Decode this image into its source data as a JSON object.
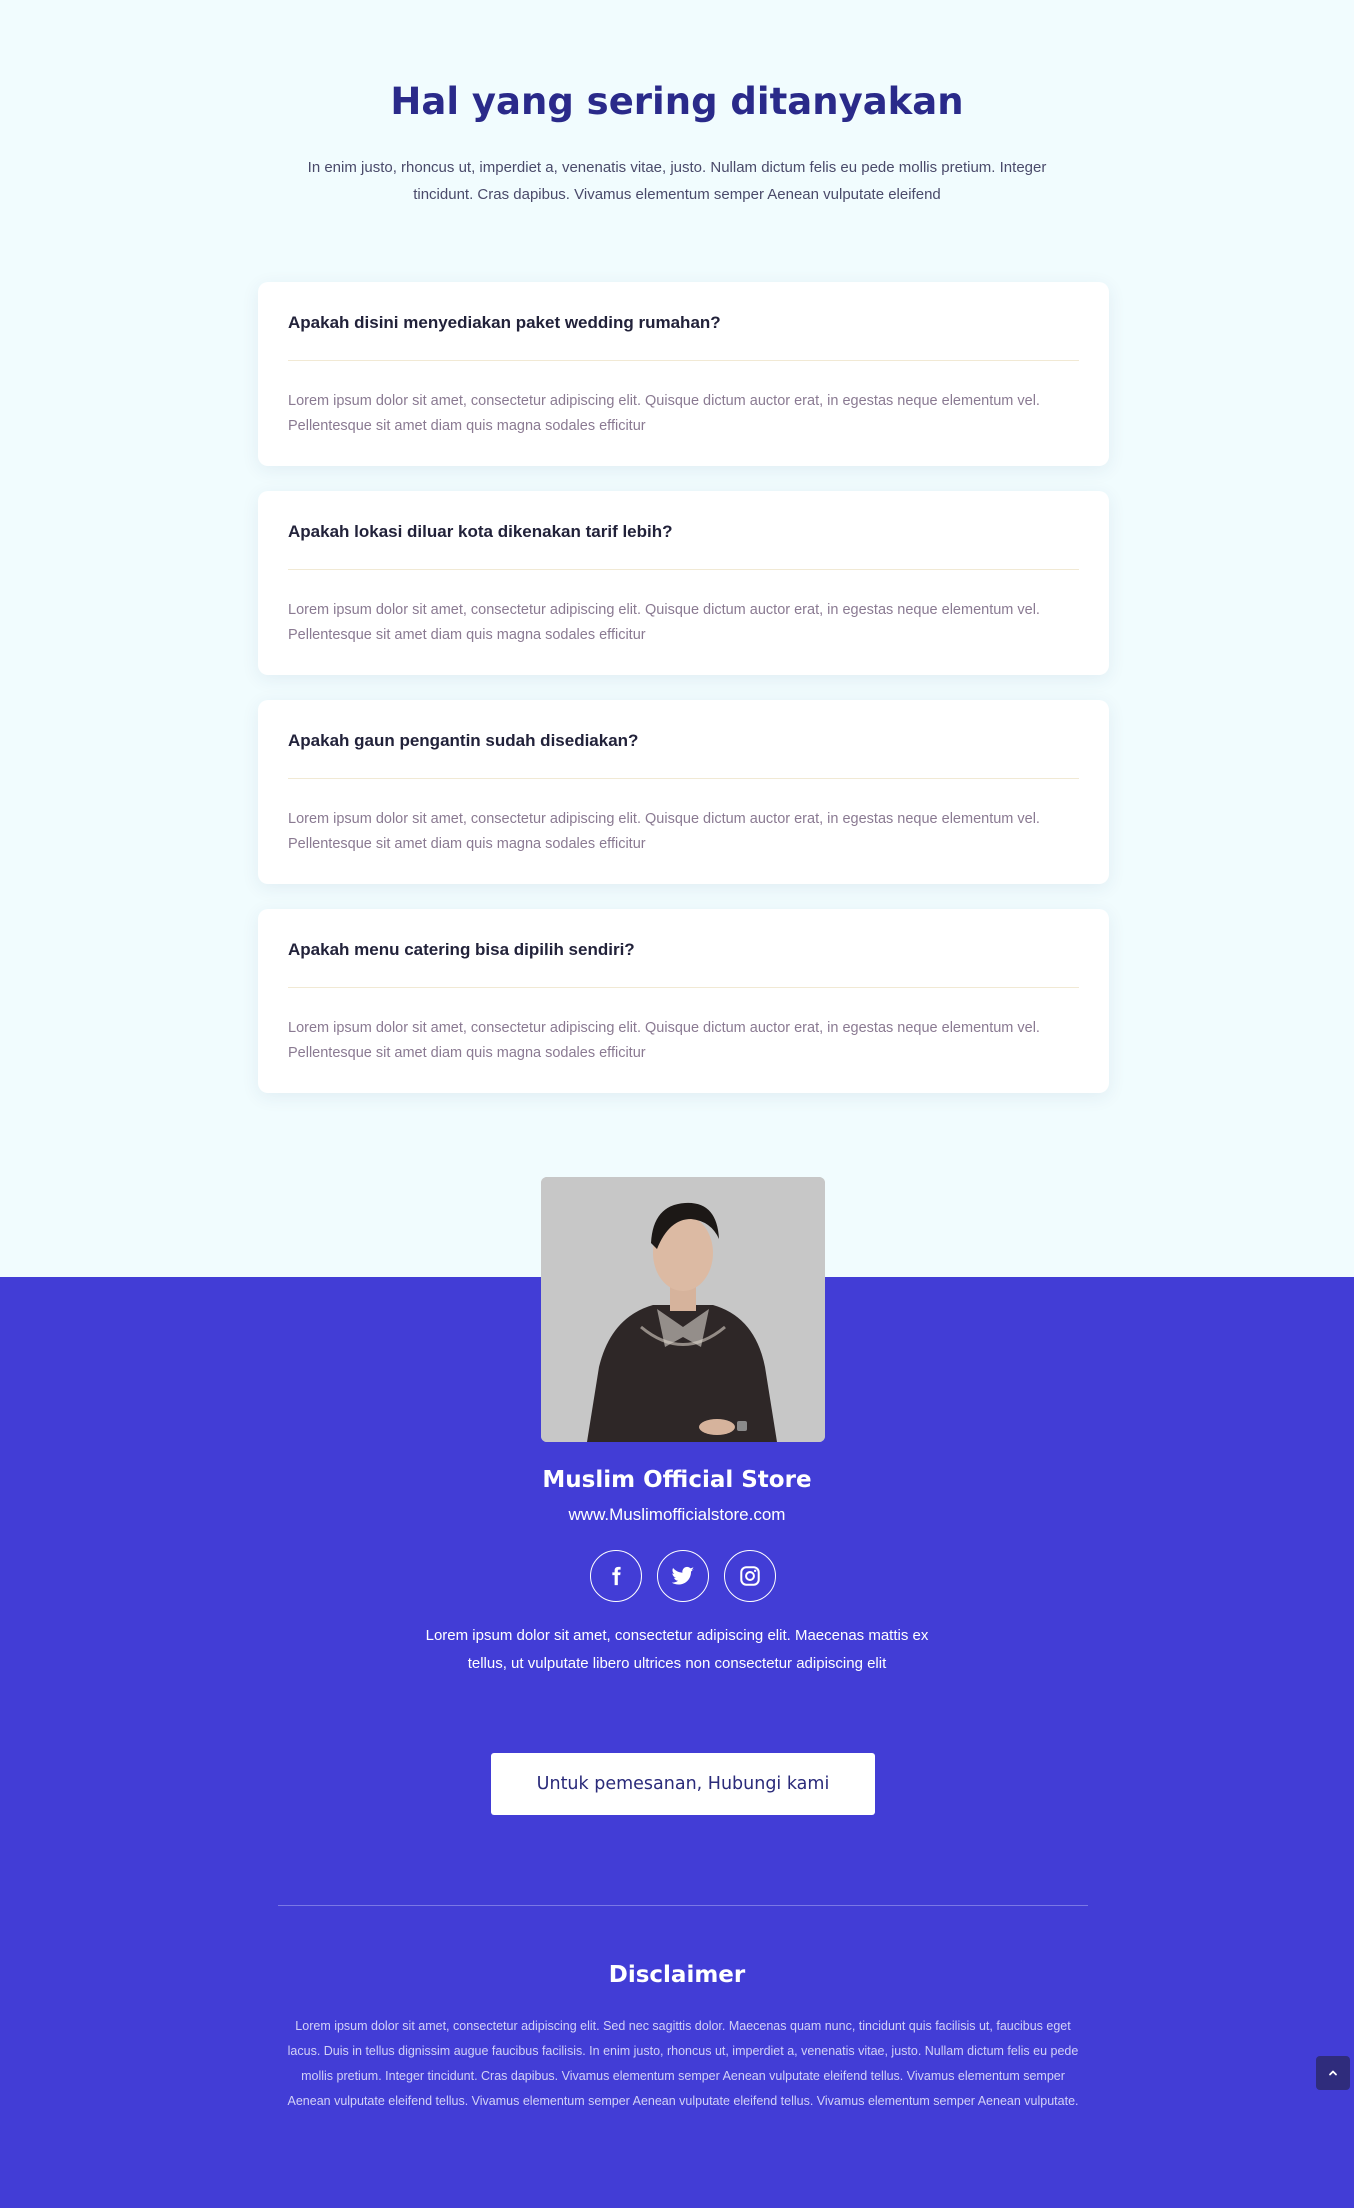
{
  "faq": {
    "title": "Hal yang sering ditanyakan",
    "intro": "In enim justo, rhoncus ut, imperdiet a, venenatis vitae, justo. Nullam dictum felis eu pede mollis pretium. Integer tincidunt. Cras dapibus. Vivamus elementum semper Aenean vulputate eleifend",
    "items": [
      {
        "question": "Apakah disini menyediakan paket wedding rumahan?",
        "answer": "Lorem ipsum dolor sit amet, consectetur adipiscing elit. Quisque dictum auctor erat, in egestas neque elementum vel. Pellentesque sit amet diam quis magna sodales efficitur"
      },
      {
        "question": "Apakah lokasi diluar kota dikenakan tarif lebih?",
        "answer": "Lorem ipsum dolor sit amet, consectetur adipiscing elit. Quisque dictum auctor erat, in egestas neque elementum vel. Pellentesque sit amet diam quis magna sodales efficitur"
      },
      {
        "question": "Apakah gaun pengantin sudah disediakan?",
        "answer": "Lorem ipsum dolor sit amet, consectetur adipiscing elit. Quisque dictum auctor erat, in egestas neque elementum vel. Pellentesque sit amet diam quis magna sodales efficitur"
      },
      {
        "question": "Apakah menu catering bisa dipilih sendiri?",
        "answer": "Lorem ipsum dolor sit amet, consectetur adipiscing elit. Quisque dictum auctor erat, in egestas neque elementum vel. Pellentesque sit amet diam quis magna sodales efficitur"
      }
    ]
  },
  "profile": {
    "name": "Muslim Official Store",
    "url": "www.Muslimofficialstore.com",
    "about": "Lorem ipsum dolor sit amet, consectetur adipiscing elit. Maecenas mattis ex tellus, ut vulputate libero ultrices non consectetur adipiscing elit",
    "social_icons": [
      "facebook-icon",
      "twitter-icon",
      "instagram-icon"
    ]
  },
  "cta": {
    "label": "Untuk pemesanan, Hubungi kami"
  },
  "disclaimer": {
    "title": "Disclaimer",
    "text": "Lorem ipsum dolor sit amet, consectetur adipiscing elit. Sed nec sagittis dolor. Maecenas quam nunc, tincidunt quis facilisis ut, faucibus eget lacus. Duis in tellus dignissim augue faucibus facilisis. In enim justo, rhoncus ut, imperdiet a, venenatis vitae, justo. Nullam dictum felis eu pede mollis pretium. Integer tincidunt. Cras dapibus. Vivamus elementum semper Aenean vulputate eleifend tellus. Vivamus elementum semper Aenean vulputate eleifend tellus. Vivamus elementum semper Aenean vulputate eleifend tellus. Vivamus elementum semper Aenean vulputate."
  },
  "colors": {
    "heading": "#2a2a8a",
    "footer_bg": "#423dd6",
    "section_bg": "#f1fcfe",
    "scroll_top_bg": "#2f2c7c"
  }
}
